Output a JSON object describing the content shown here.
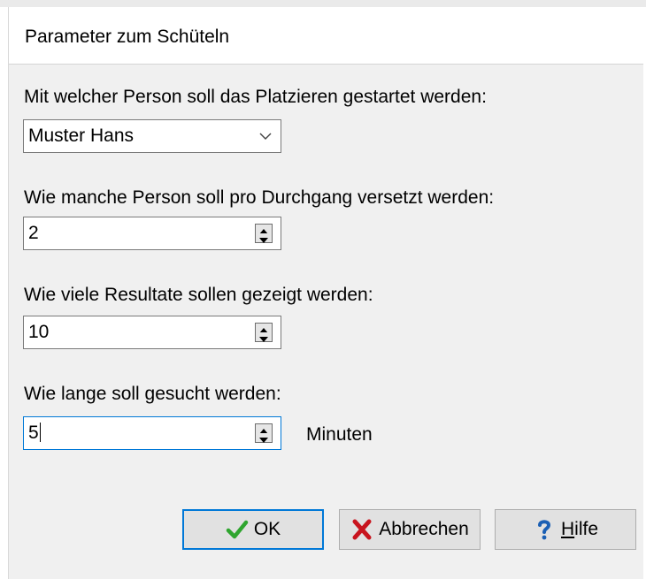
{
  "dialog": {
    "title": "Parameter zum Schüteln"
  },
  "start_person": {
    "label": "Mit welcher Person soll das Platzieren gestartet werden:",
    "value": "Muster Hans"
  },
  "persons_per_round": {
    "label": "Wie manche Person soll pro Durchgang versetzt werden:",
    "value": "2"
  },
  "results_count": {
    "label": "Wie viele Resultate sollen gezeigt werden:",
    "value": "10"
  },
  "search_duration": {
    "label": "Wie lange soll gesucht werden:",
    "value": "5",
    "unit": "Minuten"
  },
  "buttons": {
    "ok": "OK",
    "cancel": "Abbrechen",
    "help_mnemonic": "H",
    "help_rest": "ilfe"
  },
  "icons": {
    "ok": "checkmark-icon",
    "cancel": "x-icon",
    "help": "question-mark-icon"
  },
  "colors": {
    "focus_border": "#0078d7",
    "checkmark": "#2fa52f",
    "cancel_x": "#c8141e",
    "help_q": "#1a5fb4"
  }
}
